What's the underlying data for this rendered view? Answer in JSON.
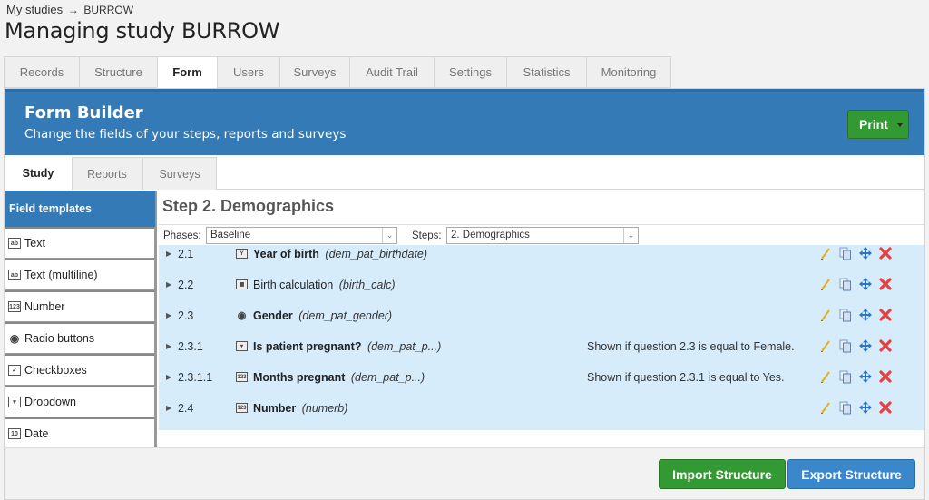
{
  "breadcrumb": {
    "root": "My studies",
    "separator": "→",
    "current": "BURROW"
  },
  "page_title": "Managing study BURROW",
  "main_tabs": [
    {
      "label": "Records",
      "active": false
    },
    {
      "label": "Structure",
      "active": false
    },
    {
      "label": "Form",
      "active": true
    },
    {
      "label": "Users",
      "active": false
    },
    {
      "label": "Surveys",
      "active": false
    },
    {
      "label": "Audit Trail",
      "active": false
    },
    {
      "label": "Settings",
      "active": false
    },
    {
      "label": "Statistics",
      "active": false
    },
    {
      "label": "Monitoring",
      "active": false
    }
  ],
  "form_builder": {
    "title": "Form Builder",
    "subtitle": "Change the fields of your steps, reports and surveys",
    "print_label": "Print",
    "accent_color": "#337ab7"
  },
  "sub_tabs": [
    {
      "label": "Study",
      "active": true
    },
    {
      "label": "Reports",
      "active": false
    },
    {
      "label": "Surveys",
      "active": false
    }
  ],
  "sidebar": {
    "header": "Field templates",
    "items": [
      {
        "label": "Text",
        "icon": "text-field-icon",
        "glyph": "ab"
      },
      {
        "label": "Text (multiline)",
        "icon": "textarea-icon",
        "glyph": "ab"
      },
      {
        "label": "Number",
        "icon": "number-icon",
        "glyph": "123"
      },
      {
        "label": "Radio buttons",
        "icon": "radio-icon",
        "glyph": "◉"
      },
      {
        "label": "Checkboxes",
        "icon": "checkbox-icon",
        "glyph": "✓"
      },
      {
        "label": "Dropdown",
        "icon": "dropdown-icon",
        "glyph": "▾"
      },
      {
        "label": "Date",
        "icon": "date-icon",
        "glyph": "10"
      }
    ]
  },
  "step": {
    "title": "Step 2. Demographics",
    "phases_label": "Phases:",
    "phases_value": "Baseline",
    "steps_label": "Steps:",
    "steps_value": "2. Demographics"
  },
  "fields": [
    {
      "number": "2.1",
      "label": "Year of birth",
      "bold": true,
      "variable": "(dem_pat_birthdate)",
      "icon": "year-icon",
      "glyph": "Y",
      "condition": ""
    },
    {
      "number": "2.2",
      "label": "Birth calculation",
      "bold": false,
      "variable": "(birth_calc)",
      "icon": "calculation-icon",
      "glyph": "▦",
      "condition": ""
    },
    {
      "number": "2.3",
      "label": "Gender",
      "bold": true,
      "variable": "(dem_pat_gender)",
      "icon": "radio-icon",
      "glyph": "◉",
      "condition": ""
    },
    {
      "number": "2.3.1",
      "label": "Is patient pregnant?",
      "bold": true,
      "variable": "(dem_pat_p...)",
      "icon": "dropdown-icon",
      "glyph": "▾",
      "condition": "Shown if question 2.3 is equal to Female."
    },
    {
      "number": "2.3.1.1",
      "label": "Months pregnant",
      "bold": true,
      "variable": "(dem_pat_p...)",
      "icon": "number-icon",
      "glyph": "123",
      "condition": "Shown if question 2.3.1 is equal to Yes."
    },
    {
      "number": "2.4",
      "label": "Number",
      "bold": true,
      "variable": "(numerb)",
      "icon": "number-icon",
      "glyph": "123",
      "condition": ""
    }
  ],
  "row_actions": [
    "edit",
    "copy",
    "move",
    "delete"
  ],
  "footer": {
    "import_label": "Import Structure",
    "export_label": "Export Structure"
  }
}
